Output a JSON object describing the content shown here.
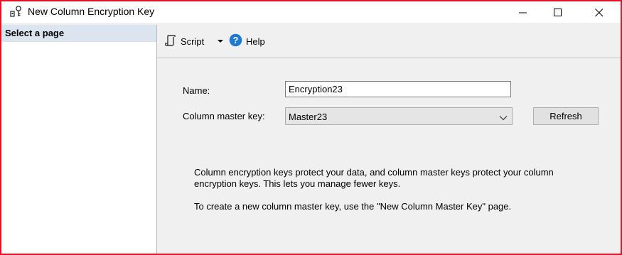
{
  "window": {
    "title": "New Column Encryption Key",
    "icon": "key-icon",
    "accent_border": "#e81123"
  },
  "sidebar": {
    "header": "Select a page"
  },
  "toolbar": {
    "script_label": "Script",
    "script_icon": "script-icon",
    "help_label": "Help",
    "help_icon": "help-icon"
  },
  "form": {
    "name_label": "Name:",
    "name_value": "Encryption23",
    "cmk_label": "Column master key:",
    "cmk_value": "Master23",
    "refresh_label": "Refresh"
  },
  "info": {
    "line1": "Column encryption keys protect your data, and column master keys protect your column encryption keys. This lets you manage fewer keys.",
    "line2": "To create a new column master key, use the \"New Column Master Key\" page."
  }
}
